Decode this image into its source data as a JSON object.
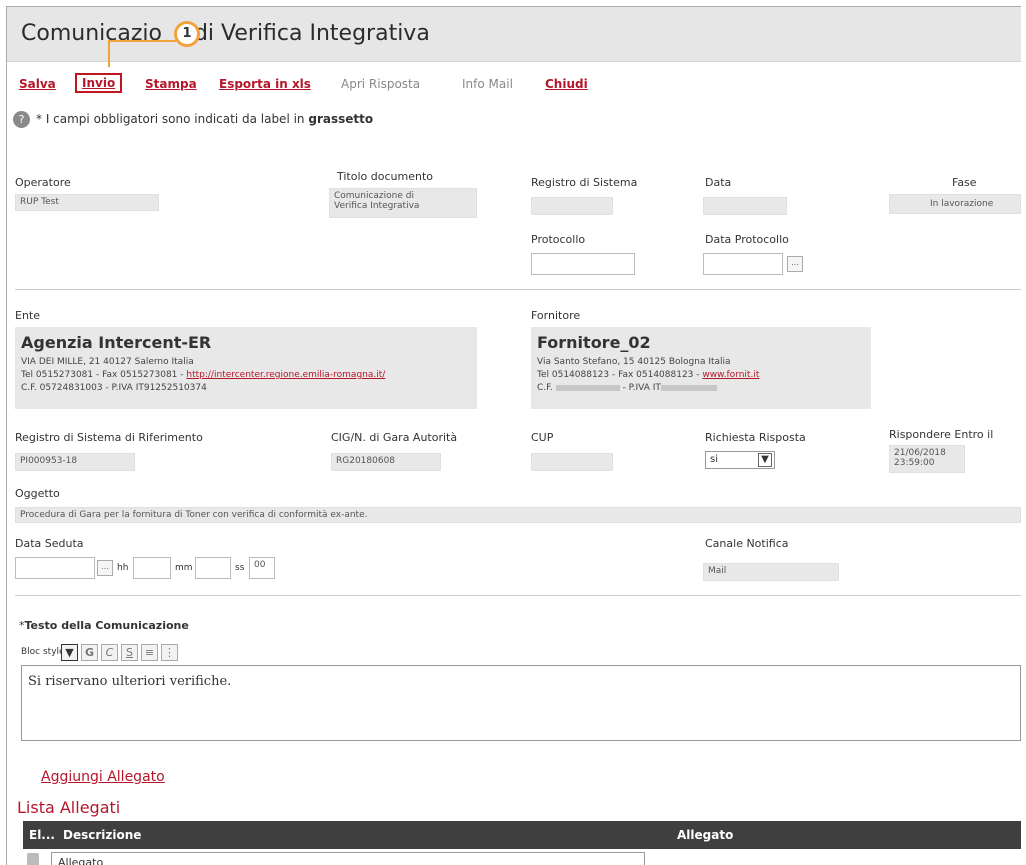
{
  "header": {
    "title_part1": "Comunicazio",
    "title_part2": "di Verifica Integrativa",
    "badge": "1"
  },
  "toolbar": {
    "salva": "Salva",
    "invio": "Invio",
    "stampa": "Stampa",
    "esporta": "Esporta in xls",
    "apri": "Apri Risposta",
    "info": "Info Mail",
    "chiudi": "Chiudi"
  },
  "help": {
    "text": "* I campi obbligatori sono indicati da label in",
    "bold": "grassetto"
  },
  "fields": {
    "operatore": {
      "label": "Operatore",
      "value": "RUP Test"
    },
    "titolo": {
      "label": "Titolo documento",
      "value_line1": "Comunicazione di",
      "value_line2": "Verifica Integrativa"
    },
    "registro": {
      "label": "Registro di Sistema",
      "value": ""
    },
    "data": {
      "label": "Data",
      "value": ""
    },
    "fase": {
      "label": "Fase",
      "value": "In lavorazione"
    },
    "protocollo": {
      "label": "Protocollo",
      "value": ""
    },
    "data_protocollo": {
      "label": "Data Protocollo",
      "value": ""
    }
  },
  "ente": {
    "label": "Ente",
    "name": "Agenzia Intercent-ER",
    "address": "VIA DEI MILLE, 21 40127 Salerno Italia",
    "tel": "Tel 0515273081 - Fax 0515273081 - ",
    "link": "http://intercenter.regione.emilia-romagna.it/",
    "cf": "C.F. 05724831003 - P.IVA IT91252510374"
  },
  "fornitore": {
    "label": "Fornitore",
    "name": "Fornitore_02",
    "address": "Via Santo Stefano, 15 40125 Bologna Italia",
    "tel": "Tel 0514088123 - Fax 0514088123 - ",
    "link": "www.fornit.it",
    "cf_prefix": "C.F.",
    "cf_mid": " - P.IVA IT"
  },
  "riferimento": {
    "registro": {
      "label": "Registro di Sistema di Riferimento",
      "value": "PI000953-18"
    },
    "cig": {
      "label": "CIG/N. di Gara Autorità",
      "value": "RG20180608"
    },
    "cup": {
      "label": "CUP",
      "value": ""
    },
    "richiesta": {
      "label": "Richiesta Risposta",
      "value": "si"
    },
    "rispondere": {
      "label": "Rispondere Entro il",
      "date": "21/06/2018",
      "time": "23:59:00"
    }
  },
  "oggetto": {
    "label": "Oggetto",
    "value": "Procedura di Gara per la fornitura di Toner con verifica di conformità ex-ante."
  },
  "seduta": {
    "label": "Data Seduta",
    "hh": "hh",
    "mm": "mm",
    "ss": "ss",
    "ss_value": "00",
    "cal": "..."
  },
  "canale": {
    "label": "Canale Notifica",
    "value": "Mail"
  },
  "testo": {
    "label": "Testo della Comunicazione",
    "required": "*",
    "style_label": "Bloc style",
    "content": "Si riservano ulteriori verifiche."
  },
  "allegati": {
    "add_link": "Aggiungi Allegato",
    "title": "Lista Allegati",
    "col_el": "El...",
    "col_desc": "Descrizione",
    "col_alleg": "Allegato",
    "row_desc": "Allegato"
  }
}
